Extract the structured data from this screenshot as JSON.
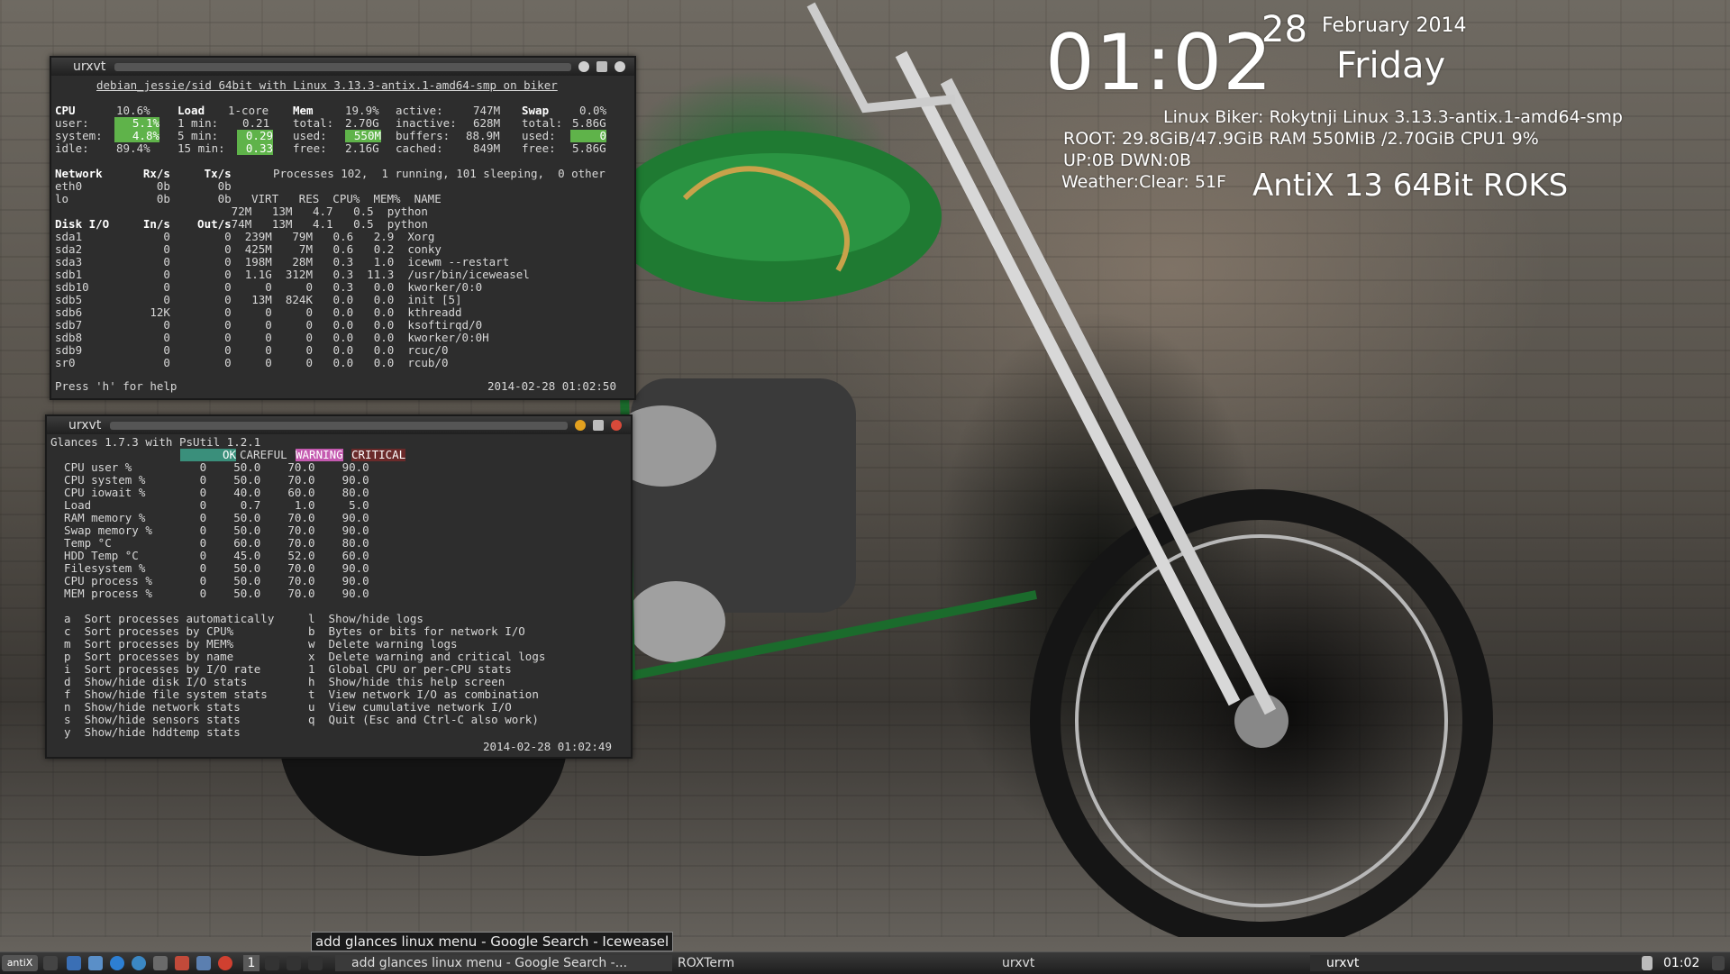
{
  "conky": {
    "time": "01:02",
    "day": "28",
    "month_year": "February 2014",
    "weekday": "Friday",
    "host_line": "Linux Biker:  Rokytnji Linux 3.13.3-antix.1-amd64-smp",
    "disk_ram_cpu": "ROOT:  29.8GiB/47.9GiB   RAM  550MiB /2.70GiB    CPU1  9%",
    "net": "UP:0B      DWN:0B",
    "weather": "Weather:Clear: 51F",
    "distro": "AntiX 13 64Bit ROKS"
  },
  "term1": {
    "title": "urxvt",
    "header": "debian_jessie/sid 64bit with Linux 3.13.3-antix.1-amd64-smp on biker",
    "cpu": {
      "label": "CPU",
      "pct": "10.6%",
      "user_l": "user:",
      "user": "5.1%",
      "system_l": "system:",
      "system": "4.8%",
      "idle_l": "idle:",
      "idle": "89.4%"
    },
    "load": {
      "label": "Load",
      "cores": "1-core",
      "m1_l": "1 min:",
      "m1": "0.21",
      "m5_l": "5 min:",
      "m5": "0.29",
      "m15_l": "15 min:",
      "m15": "0.33"
    },
    "mem": {
      "label": "Mem",
      "pct": "19.9%",
      "total_l": "total:",
      "total": "2.70G",
      "used_l": "used:",
      "used": "550M",
      "free_l": "free:",
      "free": "2.16G",
      "active_l": "active:",
      "active": "747M",
      "inactive_l": "inactive:",
      "inactive": "628M",
      "buffers_l": "buffers:",
      "buffers": "88.9M",
      "cached_l": "cached:",
      "cached": "849M"
    },
    "swap": {
      "label": "Swap",
      "pct": "0.0%",
      "total_l": "total:",
      "total": "5.86G",
      "used_l": "used:",
      "used": "0",
      "free_l": "free:",
      "free": "5.86G"
    },
    "net_header": "Network      Rx/s     Tx/s",
    "net_rows": [
      "eth0           0b       0b",
      "lo             0b       0b"
    ],
    "processes": "Processes 102,  1 running, 101 sleeping,  0 other",
    "proc_header": "VIRT   RES  CPU%  MEM%  NAME",
    "disk_header": "Disk I/O     In/s    Out/s",
    "rows": [
      "                          72M   13M   4.7   0.5  python",
      "                          74M   13M   4.1   0.5  python",
      "sda1            0        0  239M   79M   0.6   2.9  Xorg",
      "sda2            0        0  425M    7M   0.6   0.2  conky",
      "sda3            0        0  198M   28M   0.3   1.0  icewm --restart",
      "sdb1            0        0  1.1G  312M   0.3  11.3  /usr/bin/iceweasel",
      "sdb10           0        0     0     0   0.3   0.0  kworker/0:0",
      "sdb5            0        0   13M  824K   0.0   0.0  init [5]",
      "sdb6          12K        0     0     0   0.0   0.0  kthreadd",
      "sdb7            0        0     0     0   0.0   0.0  ksoftirqd/0",
      "sdb8            0        0     0     0   0.0   0.0  kworker/0:0H",
      "sdb9            0        0     0     0   0.0   0.0  rcuc/0",
      "sr0             0        0     0     0   0.0   0.0  rcub/0"
    ],
    "help": "Press 'h' for help",
    "timestamp": "2014-02-28 01:02:50"
  },
  "term2": {
    "title": "urxvt",
    "header": "Glances 1.7.3 with PsUtil 1.2.1",
    "levels": {
      "ok": "OK",
      "careful": "CAREFUL",
      "warning": "WARNING",
      "critical": "CRITICAL"
    },
    "limits": [
      "  CPU user %          0    50.0    70.0    90.0",
      "  CPU system %        0    50.0    70.0    90.0",
      "  CPU iowait %        0    40.0    60.0    80.0",
      "  Load                0     0.7     1.0     5.0",
      "  RAM memory %        0    50.0    70.0    90.0",
      "  Swap memory %       0    50.0    70.0    90.0",
      "  Temp °C             0    60.0    70.0    80.0",
      "  HDD Temp °C         0    45.0    52.0    60.0",
      "  Filesystem %        0    50.0    70.0    90.0",
      "  CPU process %       0    50.0    70.0    90.0",
      "  MEM process %       0    50.0    70.0    90.0"
    ],
    "keys": [
      "  a  Sort processes automatically     l  Show/hide logs",
      "  c  Sort processes by CPU%           b  Bytes or bits for network I/O",
      "  m  Sort processes by MEM%           w  Delete warning logs",
      "  p  Sort processes by name           x  Delete warning and critical logs",
      "  i  Sort processes by I/O rate       1  Global CPU or per-CPU stats",
      "  d  Show/hide disk I/O stats         h  Show/hide this help screen",
      "  f  Show/hide file system stats      t  View network I/O as combination",
      "  n  Show/hide network stats          u  View cumulative network I/O",
      "  s  Show/hide sensors stats          q  Quit (Esc and Ctrl-C also work)",
      "  y  Show/hide hddtemp stats"
    ],
    "timestamp": "2014-02-28 01:02:49"
  },
  "tooltip": "add glances linux menu - Google Search - Iceweasel",
  "taskbar": {
    "start_label": "antiX",
    "workspace": "1",
    "task1": "add glances linux menu - Google Search -...",
    "task2": "ROXTerm",
    "task3": "urxvt",
    "task4": "urxvt",
    "clock": "01:02"
  }
}
